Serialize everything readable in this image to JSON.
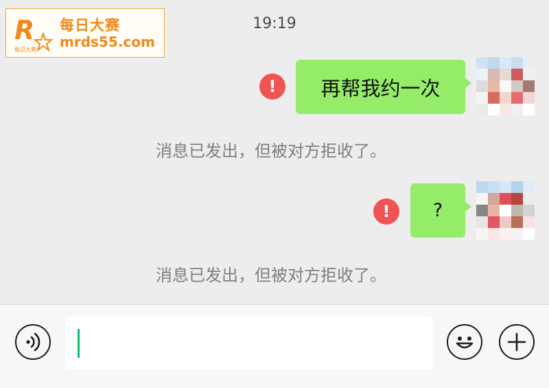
{
  "watermark": {
    "title": "每日大赛",
    "url": "mrds55.com",
    "logo_letter": "R",
    "logo_caption": "每日大赛"
  },
  "chat": {
    "timestamp": "19:19",
    "messages": [
      {
        "text": "再帮我约一次",
        "status_icon": "error-icon",
        "status_glyph": "!",
        "notice": "消息已发出，但被对方拒收了。"
      },
      {
        "text": "?",
        "status_icon": "error-icon",
        "status_glyph": "!",
        "notice": "消息已发出，但被对方拒收了。"
      }
    ]
  },
  "input_bar": {
    "voice_icon": "voice-icon",
    "emoji_icon": "emoji-icon",
    "plus_icon": "plus-icon",
    "text_value": ""
  },
  "colors": {
    "bubble": "#95ec69",
    "error": "#f05353",
    "caret": "#07c160",
    "background": "#ededed",
    "watermark": "#f08a1c"
  }
}
